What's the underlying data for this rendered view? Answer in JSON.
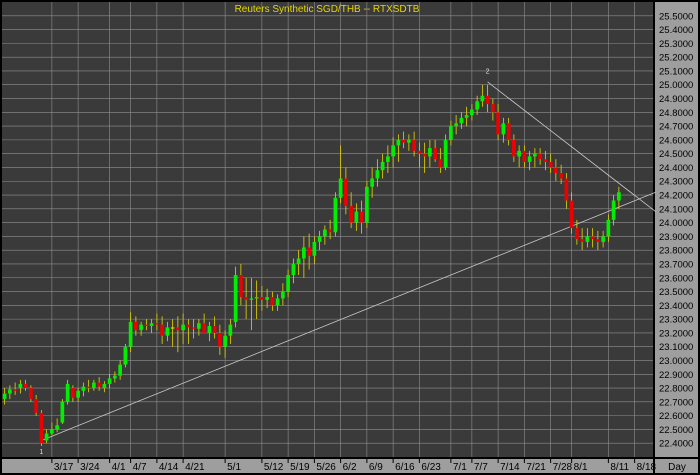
{
  "chart_data": {
    "type": "candlestick",
    "title": "Reuters  Synthetic  SGD/THB  --  RTXSDTB",
    "x_unit": "Day",
    "y_axis": {
      "min": 22.3,
      "max": 25.6,
      "step": 0.1,
      "decimals": 4,
      "side": "right",
      "labels_shown": [
        "22.4000",
        "22.5000",
        "22.6000",
        "22.7000",
        "22.8000",
        "22.9000",
        "23.0000",
        "23.1000",
        "23.2000",
        "23.3000",
        "23.4000",
        "23.5000",
        "23.6000",
        "23.7000",
        "23.8000",
        "23.9000",
        "24.0000",
        "24.1000",
        "24.2000",
        "24.3000",
        "24.4000",
        "24.5000",
        "24.6000",
        "24.7000",
        "24.8000",
        "24.9000",
        "25.0000",
        "25.1000",
        "25.2000",
        "25.3000",
        "25.4000",
        "25.5000"
      ]
    },
    "x_axis": {
      "tick_labels": [
        {
          "label": "3/17",
          "index": 9
        },
        {
          "label": "3/24",
          "index": 14
        },
        {
          "label": "4/1",
          "index": 20
        },
        {
          "label": "4/7",
          "index": 24
        },
        {
          "label": "4/14",
          "index": 29
        },
        {
          "label": "4/21",
          "index": 34
        },
        {
          "label": "5/1",
          "index": 42
        },
        {
          "label": "5/12",
          "index": 49
        },
        {
          "label": "5/19",
          "index": 54
        },
        {
          "label": "5/26",
          "index": 59
        },
        {
          "label": "6/2",
          "index": 64
        },
        {
          "label": "6/9",
          "index": 69
        },
        {
          "label": "6/16",
          "index": 74
        },
        {
          "label": "6/23",
          "index": 79
        },
        {
          "label": "7/1",
          "index": 85
        },
        {
          "label": "7/7",
          "index": 89
        },
        {
          "label": "7/14",
          "index": 94
        },
        {
          "label": "7/21",
          "index": 99
        },
        {
          "label": "7/28",
          "index": 104
        },
        {
          "label": "8/1",
          "index": 108
        },
        {
          "label": "8/11",
          "index": 115
        },
        {
          "label": "8/18",
          "index": 120
        }
      ],
      "day_count": 124
    },
    "grid": true,
    "colors": {
      "background": "#000000",
      "plot": "#3a3a3a",
      "grid": "#909090",
      "up": "#00ee00",
      "down": "#ee0000",
      "doji": "#e6d600",
      "trendline": "#c8c8c8",
      "title": "#e6d600",
      "axis_text": "#000000"
    },
    "trendlines": [
      {
        "from": {
          "index": 7,
          "value": 22.42
        },
        "to": {
          "index": 124,
          "value": 24.22
        }
      },
      {
        "from": {
          "index": 92,
          "value": 25.02
        },
        "to": {
          "index": 124,
          "value": 24.08
        }
      }
    ],
    "markers": [
      {
        "label": "1",
        "index": 7,
        "value": 22.32
      },
      {
        "label": "2",
        "index": 92,
        "value": 25.08
      }
    ],
    "candles": [
      {
        "o": 22.72,
        "h": 22.8,
        "l": 22.68,
        "c": 22.76
      },
      {
        "o": 22.76,
        "h": 22.82,
        "l": 22.72,
        "c": 22.79
      },
      {
        "o": 22.79,
        "h": 22.84,
        "l": 22.75,
        "c": 22.78
      },
      {
        "o": 22.8,
        "h": 22.86,
        "l": 22.76,
        "c": 22.83
      },
      {
        "o": 22.83,
        "h": 22.86,
        "l": 22.78,
        "c": 22.8
      },
      {
        "o": 22.8,
        "h": 22.82,
        "l": 22.7,
        "c": 22.72
      },
      {
        "o": 22.72,
        "h": 22.75,
        "l": 22.6,
        "c": 22.62
      },
      {
        "o": 22.62,
        "h": 22.64,
        "l": 22.38,
        "c": 22.4
      },
      {
        "o": 22.42,
        "h": 22.5,
        "l": 22.4,
        "c": 22.47
      },
      {
        "o": 22.47,
        "h": 22.55,
        "l": 22.46,
        "c": 22.5
      },
      {
        "o": 22.5,
        "h": 22.58,
        "l": 22.48,
        "c": 22.53
      },
      {
        "o": 22.55,
        "h": 22.72,
        "l": 22.54,
        "c": 22.7
      },
      {
        "o": 22.7,
        "h": 22.86,
        "l": 22.68,
        "c": 22.83
      },
      {
        "o": 22.8,
        "h": 22.82,
        "l": 22.7,
        "c": 22.73
      },
      {
        "o": 22.73,
        "h": 22.8,
        "l": 22.7,
        "c": 22.78
      },
      {
        "o": 22.78,
        "h": 22.84,
        "l": 22.74,
        "c": 22.81
      },
      {
        "o": 22.81,
        "h": 22.86,
        "l": 22.77,
        "c": 22.8
      },
      {
        "o": 22.8,
        "h": 22.86,
        "l": 22.78,
        "c": 22.84
      },
      {
        "o": 22.84,
        "h": 22.88,
        "l": 22.78,
        "c": 22.81
      },
      {
        "o": 22.8,
        "h": 22.85,
        "l": 22.77,
        "c": 22.83
      },
      {
        "o": 22.83,
        "h": 22.9,
        "l": 22.8,
        "c": 22.87
      },
      {
        "o": 22.87,
        "h": 22.92,
        "l": 22.84,
        "c": 22.89
      },
      {
        "o": 22.89,
        "h": 23.0,
        "l": 22.86,
        "c": 22.97
      },
      {
        "o": 22.97,
        "h": 23.12,
        "l": 22.95,
        "c": 23.1
      },
      {
        "o": 23.1,
        "h": 23.35,
        "l": 23.06,
        "c": 23.28
      },
      {
        "o": 23.28,
        "h": 23.32,
        "l": 23.18,
        "c": 23.22
      },
      {
        "o": 23.22,
        "h": 23.28,
        "l": 23.18,
        "c": 23.26
      },
      {
        "o": 23.26,
        "h": 23.3,
        "l": 23.22,
        "c": 23.25
      },
      {
        "o": 23.25,
        "h": 23.3,
        "l": 23.2,
        "c": 23.27
      },
      {
        "o": 23.27,
        "h": 23.34,
        "l": 23.22,
        "c": 23.26
      },
      {
        "o": 23.26,
        "h": 23.32,
        "l": 23.12,
        "c": 23.18
      },
      {
        "o": 23.18,
        "h": 23.28,
        "l": 23.14,
        "c": 23.24
      },
      {
        "o": 23.24,
        "h": 23.3,
        "l": 23.1,
        "c": 23.24
      },
      {
        "o": 23.24,
        "h": 23.32,
        "l": 23.06,
        "c": 23.22
      },
      {
        "o": 23.22,
        "h": 23.34,
        "l": 23.12,
        "c": 23.26
      },
      {
        "o": 23.26,
        "h": 23.3,
        "l": 23.12,
        "c": 23.24
      },
      {
        "o": 23.24,
        "h": 23.3,
        "l": 23.16,
        "c": 23.23
      },
      {
        "o": 23.23,
        "h": 23.3,
        "l": 23.18,
        "c": 23.27
      },
      {
        "o": 23.27,
        "h": 23.34,
        "l": 23.22,
        "c": 23.2
      },
      {
        "o": 23.2,
        "h": 23.28,
        "l": 23.14,
        "c": 23.25
      },
      {
        "o": 23.25,
        "h": 23.32,
        "l": 23.16,
        "c": 23.2
      },
      {
        "o": 23.2,
        "h": 23.26,
        "l": 23.04,
        "c": 23.1
      },
      {
        "o": 23.1,
        "h": 23.22,
        "l": 23.02,
        "c": 23.18
      },
      {
        "o": 23.18,
        "h": 23.3,
        "l": 23.12,
        "c": 23.26
      },
      {
        "o": 23.28,
        "h": 23.68,
        "l": 23.24,
        "c": 23.62
      },
      {
        "o": 23.62,
        "h": 23.7,
        "l": 23.4,
        "c": 23.46
      },
      {
        "o": 23.46,
        "h": 23.6,
        "l": 23.3,
        "c": 23.44
      },
      {
        "o": 23.44,
        "h": 23.6,
        "l": 23.22,
        "c": 23.45
      },
      {
        "o": 23.45,
        "h": 23.58,
        "l": 23.3,
        "c": 23.46
      },
      {
        "o": 23.46,
        "h": 23.54,
        "l": 23.36,
        "c": 23.44
      },
      {
        "o": 23.44,
        "h": 23.52,
        "l": 23.38,
        "c": 23.46
      },
      {
        "o": 23.46,
        "h": 23.5,
        "l": 23.36,
        "c": 23.4
      },
      {
        "o": 23.4,
        "h": 23.48,
        "l": 23.36,
        "c": 23.45
      },
      {
        "o": 23.45,
        "h": 23.56,
        "l": 23.4,
        "c": 23.5
      },
      {
        "o": 23.5,
        "h": 23.66,
        "l": 23.46,
        "c": 23.62
      },
      {
        "o": 23.62,
        "h": 23.74,
        "l": 23.56,
        "c": 23.7
      },
      {
        "o": 23.7,
        "h": 23.8,
        "l": 23.62,
        "c": 23.74
      },
      {
        "o": 23.74,
        "h": 23.9,
        "l": 23.6,
        "c": 23.82
      },
      {
        "o": 23.82,
        "h": 23.92,
        "l": 23.66,
        "c": 23.76
      },
      {
        "o": 23.76,
        "h": 23.9,
        "l": 23.7,
        "c": 23.86
      },
      {
        "o": 23.86,
        "h": 23.94,
        "l": 23.8,
        "c": 23.9
      },
      {
        "o": 23.9,
        "h": 23.98,
        "l": 23.84,
        "c": 23.95
      },
      {
        "o": 23.95,
        "h": 24.02,
        "l": 23.88,
        "c": 23.93
      },
      {
        "o": 23.93,
        "h": 24.22,
        "l": 23.9,
        "c": 24.18
      },
      {
        "o": 24.18,
        "h": 24.56,
        "l": 24.14,
        "c": 24.32
      },
      {
        "o": 24.32,
        "h": 24.4,
        "l": 24.06,
        "c": 24.12
      },
      {
        "o": 24.12,
        "h": 24.22,
        "l": 23.96,
        "c": 24.0
      },
      {
        "o": 24.0,
        "h": 24.14,
        "l": 23.94,
        "c": 24.08
      },
      {
        "o": 24.08,
        "h": 24.16,
        "l": 23.92,
        "c": 24.0
      },
      {
        "o": 24.0,
        "h": 24.3,
        "l": 23.96,
        "c": 24.26
      },
      {
        "o": 24.26,
        "h": 24.4,
        "l": 24.18,
        "c": 24.32
      },
      {
        "o": 24.32,
        "h": 24.46,
        "l": 24.26,
        "c": 24.38
      },
      {
        "o": 24.38,
        "h": 24.5,
        "l": 24.32,
        "c": 24.44
      },
      {
        "o": 24.44,
        "h": 24.56,
        "l": 24.36,
        "c": 24.48
      },
      {
        "o": 24.48,
        "h": 24.62,
        "l": 24.4,
        "c": 24.56
      },
      {
        "o": 24.56,
        "h": 24.64,
        "l": 24.44,
        "c": 24.6
      },
      {
        "o": 24.6,
        "h": 24.66,
        "l": 24.54,
        "c": 24.58
      },
      {
        "o": 24.58,
        "h": 24.64,
        "l": 24.52,
        "c": 24.6
      },
      {
        "o": 24.6,
        "h": 24.66,
        "l": 24.48,
        "c": 24.52
      },
      {
        "o": 24.52,
        "h": 24.58,
        "l": 24.4,
        "c": 24.5
      },
      {
        "o": 24.5,
        "h": 24.58,
        "l": 24.36,
        "c": 24.48
      },
      {
        "o": 24.48,
        "h": 24.6,
        "l": 24.4,
        "c": 24.54
      },
      {
        "o": 24.54,
        "h": 24.6,
        "l": 24.44,
        "c": 24.46
      },
      {
        "o": 24.46,
        "h": 24.54,
        "l": 24.36,
        "c": 24.4
      },
      {
        "o": 24.4,
        "h": 24.64,
        "l": 24.38,
        "c": 24.6
      },
      {
        "o": 24.6,
        "h": 24.74,
        "l": 24.56,
        "c": 24.7
      },
      {
        "o": 24.7,
        "h": 24.78,
        "l": 24.64,
        "c": 24.72
      },
      {
        "o": 24.72,
        "h": 24.8,
        "l": 24.68,
        "c": 24.76
      },
      {
        "o": 24.76,
        "h": 24.84,
        "l": 24.7,
        "c": 24.78
      },
      {
        "o": 24.78,
        "h": 24.86,
        "l": 24.74,
        "c": 24.82
      },
      {
        "o": 24.82,
        "h": 24.92,
        "l": 24.78,
        "c": 24.88
      },
      {
        "o": 24.88,
        "h": 25.0,
        "l": 24.84,
        "c": 24.92
      },
      {
        "o": 24.92,
        "h": 25.0,
        "l": 24.8,
        "c": 24.86
      },
      {
        "o": 24.86,
        "h": 24.9,
        "l": 24.74,
        "c": 24.8
      },
      {
        "o": 24.8,
        "h": 24.86,
        "l": 24.6,
        "c": 24.64
      },
      {
        "o": 24.64,
        "h": 24.76,
        "l": 24.58,
        "c": 24.72
      },
      {
        "o": 24.72,
        "h": 24.76,
        "l": 24.56,
        "c": 24.6
      },
      {
        "o": 24.6,
        "h": 24.64,
        "l": 24.44,
        "c": 24.48
      },
      {
        "o": 24.48,
        "h": 24.56,
        "l": 24.4,
        "c": 24.52
      },
      {
        "o": 24.52,
        "h": 24.56,
        "l": 24.4,
        "c": 24.44
      },
      {
        "o": 24.44,
        "h": 24.52,
        "l": 24.38,
        "c": 24.48
      },
      {
        "o": 24.48,
        "h": 24.54,
        "l": 24.4,
        "c": 24.5
      },
      {
        "o": 24.5,
        "h": 24.54,
        "l": 24.42,
        "c": 24.46
      },
      {
        "o": 24.46,
        "h": 24.52,
        "l": 24.38,
        "c": 24.44
      },
      {
        "o": 24.44,
        "h": 24.5,
        "l": 24.36,
        "c": 24.4
      },
      {
        "o": 24.4,
        "h": 24.46,
        "l": 24.3,
        "c": 24.36
      },
      {
        "o": 24.36,
        "h": 24.42,
        "l": 24.28,
        "c": 24.32
      },
      {
        "o": 24.32,
        "h": 24.36,
        "l": 24.1,
        "c": 24.16
      },
      {
        "o": 24.16,
        "h": 24.22,
        "l": 23.92,
        "c": 23.96
      },
      {
        "o": 23.96,
        "h": 24.02,
        "l": 23.84,
        "c": 23.88
      },
      {
        "o": 23.88,
        "h": 23.96,
        "l": 23.8,
        "c": 23.86
      },
      {
        "o": 23.86,
        "h": 23.96,
        "l": 23.82,
        "c": 23.9
      },
      {
        "o": 23.9,
        "h": 23.96,
        "l": 23.82,
        "c": 23.88
      },
      {
        "o": 23.88,
        "h": 23.94,
        "l": 23.8,
        "c": 23.86
      },
      {
        "o": 23.86,
        "h": 23.94,
        "l": 23.82,
        "c": 23.9
      },
      {
        "o": 23.9,
        "h": 24.06,
        "l": 23.86,
        "c": 24.02
      },
      {
        "o": 24.02,
        "h": 24.2,
        "l": 23.98,
        "c": 24.16
      },
      {
        "o": 24.16,
        "h": 24.26,
        "l": 24.1,
        "c": 24.22
      }
    ]
  }
}
